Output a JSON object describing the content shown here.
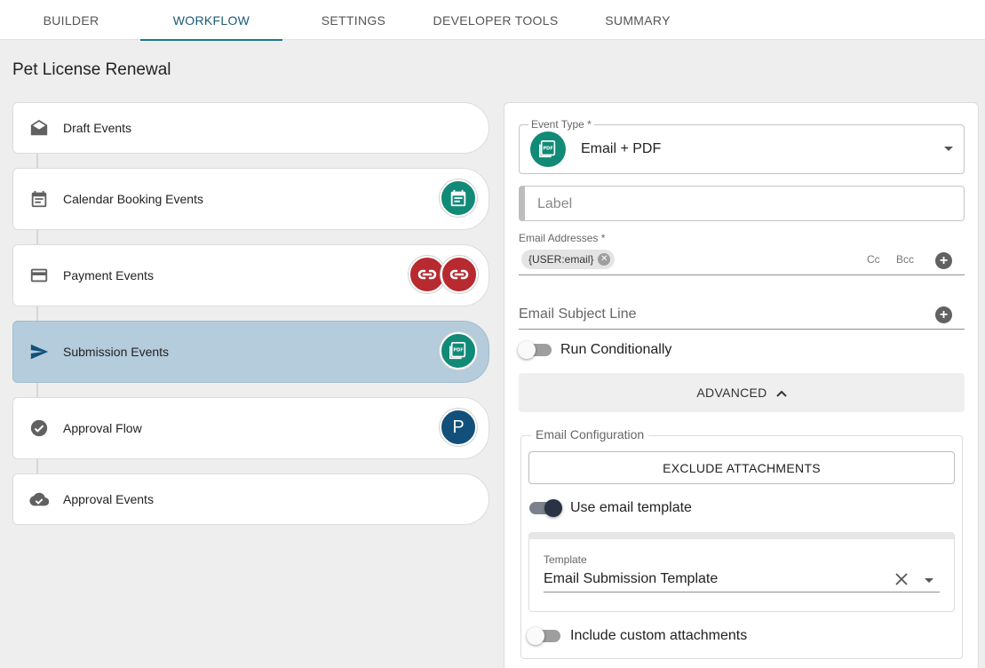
{
  "tabs": [
    {
      "label": "BUILDER",
      "active": false
    },
    {
      "label": "WORKFLOW",
      "active": true
    },
    {
      "label": "SETTINGS",
      "active": false
    },
    {
      "label": "DEVELOPER TOOLS",
      "active": false
    },
    {
      "label": "SUMMARY",
      "active": false
    }
  ],
  "page_title": "Pet License Renewal",
  "events": [
    {
      "label": "Draft Events",
      "icon": "envelope-open-icon"
    },
    {
      "label": "Calendar Booking Events",
      "icon": "calendar-icon",
      "badge": "calendar-icon"
    },
    {
      "label": "Payment Events",
      "icon": "credit-card-icon",
      "badges": [
        "payment-link-icon",
        "payment-link-icon"
      ]
    },
    {
      "label": "Submission Events",
      "icon": "send-icon",
      "badge": "pdf-icon",
      "selected": true
    },
    {
      "label": "Approval Flow",
      "icon": "check-circle-icon",
      "badge_text": "P"
    },
    {
      "label": "Approval Events",
      "icon": "cloud-check-icon"
    }
  ],
  "panel": {
    "event_type": {
      "label": "Event Type *",
      "value": "Email + PDF",
      "icon": "pdf-icon"
    },
    "label_field": {
      "placeholder": "Label"
    },
    "email_addresses": {
      "label": "Email Addresses *",
      "chip": "{USER:email}",
      "cc": "Cc",
      "bcc": "Bcc"
    },
    "subject": {
      "placeholder": "Email Subject Line"
    },
    "run_conditionally": {
      "label": "Run Conditionally",
      "on": false
    },
    "advanced": {
      "label": "ADVANCED"
    },
    "email_config": {
      "legend": "Email Configuration",
      "exclude_button": "EXCLUDE ATTACHMENTS",
      "use_template": {
        "label": "Use email template",
        "on": true
      },
      "template": {
        "label": "Template",
        "value": "Email Submission Template"
      },
      "custom_attachments": {
        "label": "Include custom attachments",
        "on": false
      }
    }
  },
  "colors": {
    "teal": "#118a77",
    "red": "#b72a30",
    "navy": "#12507b",
    "selected": "#b4ccdc",
    "tab_accent": "#1b7a8c"
  }
}
